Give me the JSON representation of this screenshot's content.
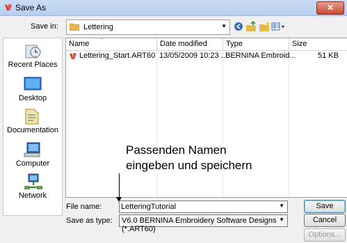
{
  "window": {
    "title": "Save As",
    "close_label": "✕"
  },
  "savein": {
    "label": "Save in:",
    "folder": "Lettering"
  },
  "places": [
    {
      "label": "Recent Places",
      "icon": "recent-places-icon"
    },
    {
      "label": "Desktop",
      "icon": "desktop-icon"
    },
    {
      "label": "Documentation",
      "icon": "documents-icon"
    },
    {
      "label": "Computer",
      "icon": "computer-icon"
    },
    {
      "label": "Network",
      "icon": "network-icon"
    }
  ],
  "columns": {
    "name": "Name",
    "date": "Date modified",
    "type": "Type",
    "size": "Size"
  },
  "files": [
    {
      "name": "Lettering_Start.ART60",
      "date": "13/05/2009 10:23 ...",
      "type": "BERNINA Embroid...",
      "size": "51 KB"
    }
  ],
  "annotation": {
    "line1": "Passenden Namen",
    "line2": "eingeben und speichern"
  },
  "filename": {
    "label": "File name:",
    "value": "LetteringTutorial"
  },
  "savetype": {
    "label": "Save as type:",
    "value": "V6.0 BERNINA Embroidery Software Designs (*.ART60)"
  },
  "buttons": {
    "save": "Save",
    "cancel": "Cancel",
    "options": "Options..."
  }
}
